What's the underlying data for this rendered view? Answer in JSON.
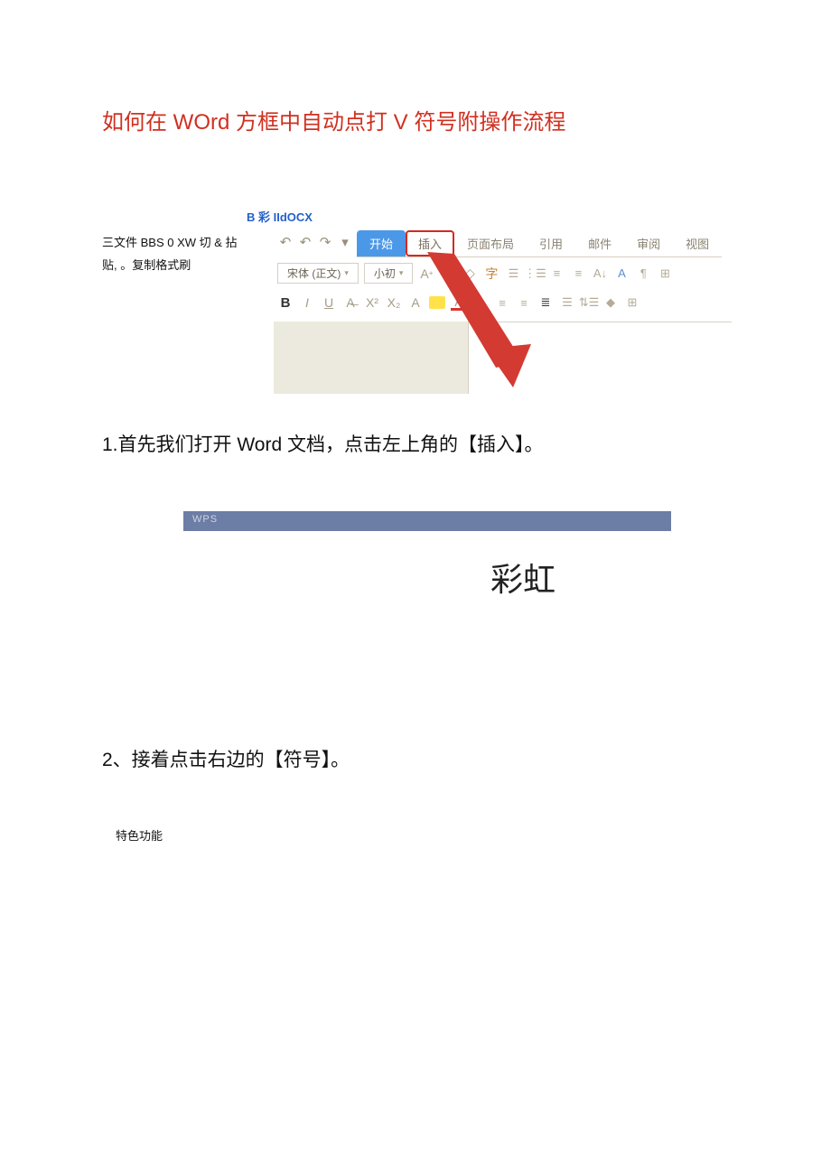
{
  "title": "如何在 WOrd 方框中自动点打 V 符号附操作流程",
  "blueLabel": "B 彩 IIdOCX",
  "sideText1": "三文件 BBS 0 XW 切 & 拈",
  "sideText2": "贴,  。复制格式刷",
  "tabs": {
    "start": "开始",
    "insert": "插入",
    "layout": "页面布局",
    "ref": "引用",
    "mail": "邮件",
    "review": "审阅",
    "view": "视图"
  },
  "fontName": "宋体 (正文)",
  "fontSize": "小初",
  "step1": "1.首先我们打开 Word 文档，点击左上角的【插入】。",
  "wpsLabel": "WPS",
  "rainbow": "彩虹",
  "step2": "2、接着点击右边的【符号】。",
  "feature": "特色功能"
}
